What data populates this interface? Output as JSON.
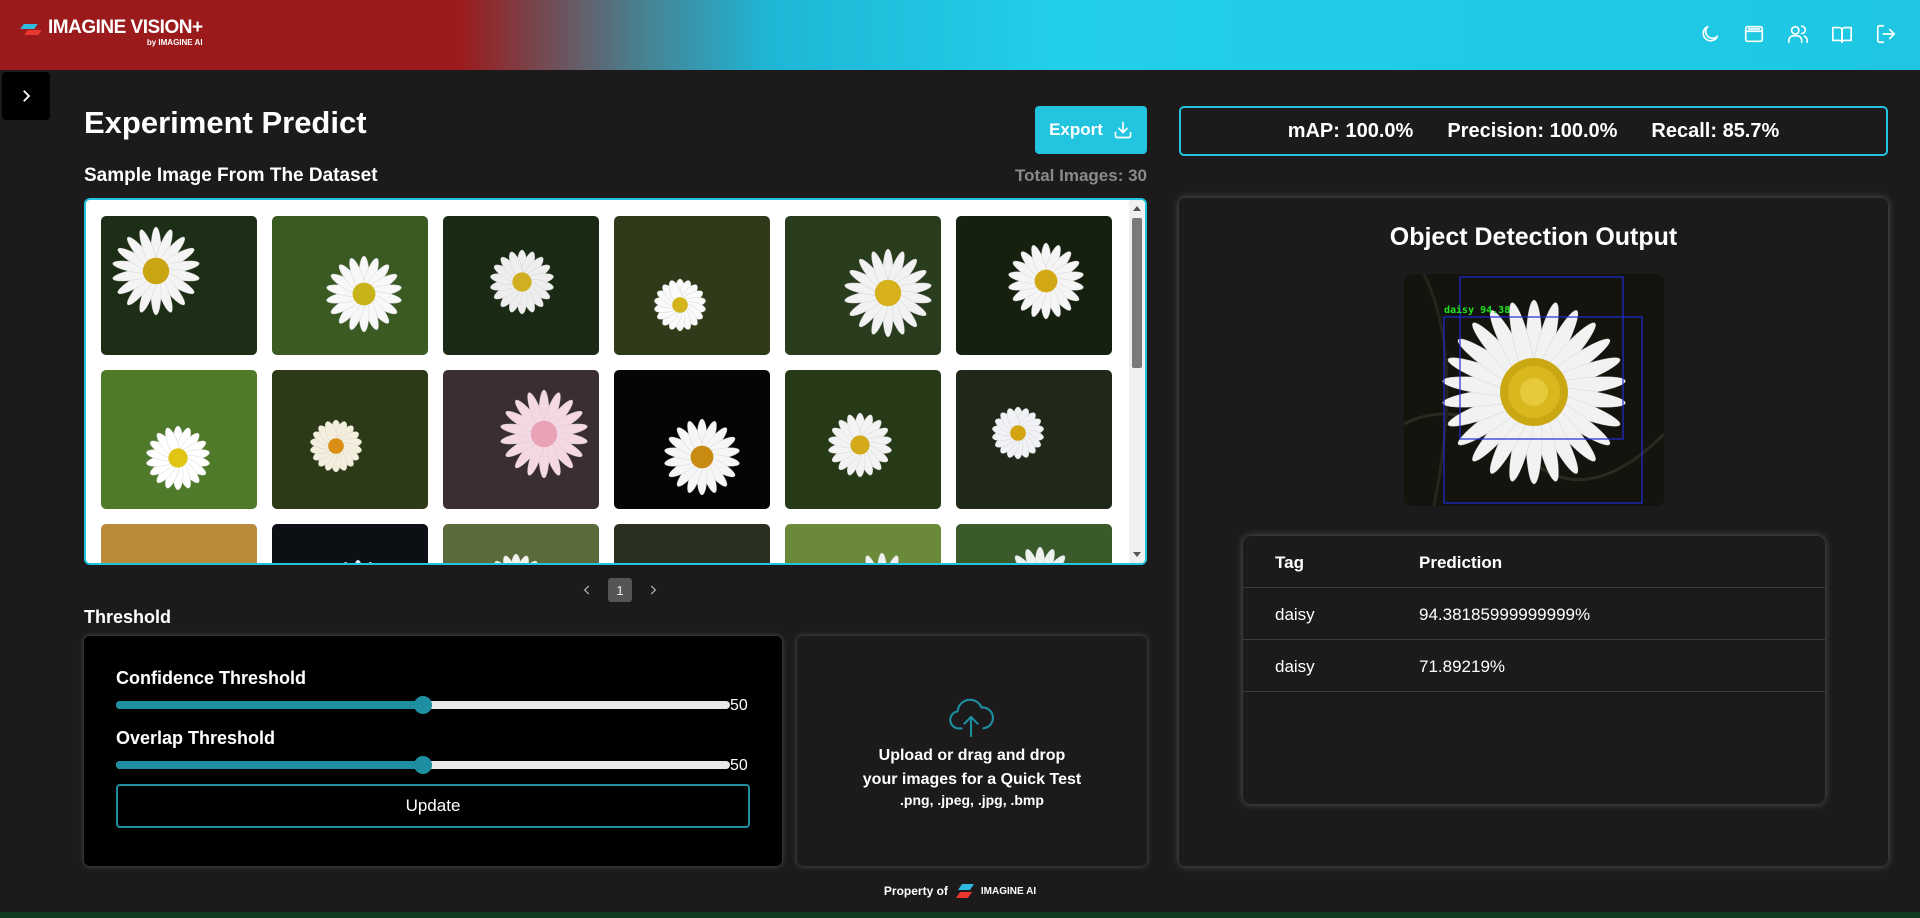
{
  "header": {
    "app_title": "IMAGINE VISION+",
    "app_subtitle": "by IMAGINE AI",
    "icons": [
      "moon-icon",
      "layout-icon",
      "users-icon",
      "book-icon",
      "logout-icon"
    ]
  },
  "sidebar": {
    "toggle_icon": "chevron-right-icon"
  },
  "page": {
    "title": "Experiment Predict",
    "export_label": "Export",
    "dataset_label": "Sample Image From The Dataset",
    "total_images": "Total Images: 30"
  },
  "gallery": {
    "thumbnails": [
      "daisy",
      "daisy",
      "daisy",
      "daisy",
      "daisy",
      "daisy",
      "daisy",
      "daisy",
      "daisy",
      "daisy",
      "daisy",
      "daisy",
      "daisy",
      "daisy",
      "daisy",
      "daisy",
      "daisy",
      "daisy"
    ],
    "current_page": "1"
  },
  "threshold": {
    "section_label": "Threshold",
    "confidence": {
      "label": "Confidence Threshold",
      "value": "50",
      "fraction": 0.5
    },
    "overlap": {
      "label": "Overlap Threshold",
      "value": "50",
      "fraction": 0.5
    },
    "update_label": "Update"
  },
  "upload": {
    "line1": "Upload or drag and drop",
    "line2": "your images for a Quick Test",
    "formats": ".png, .jpeg, .jpg, .bmp"
  },
  "metrics": {
    "map": "mAP: 100.0%",
    "precision": "Precision: 100.0%",
    "recall": "Recall: 85.7%"
  },
  "output": {
    "title": "Object Detection Output",
    "detection_label": "daisy 94.38",
    "table": {
      "headers": {
        "tag": "Tag",
        "prediction": "Prediction"
      },
      "rows": [
        {
          "tag": "daisy",
          "prediction": "94.38185999999999%"
        },
        {
          "tag": "daisy",
          "prediction": "71.89219%"
        }
      ]
    }
  },
  "footer": {
    "property_label": "Property of",
    "brand": "IMAGINE AI"
  },
  "colors": {
    "accent": "#22c4e0",
    "slider": "#1d8fa0",
    "header_red": "#9b1b1d",
    "background": "#1c1a1a"
  }
}
